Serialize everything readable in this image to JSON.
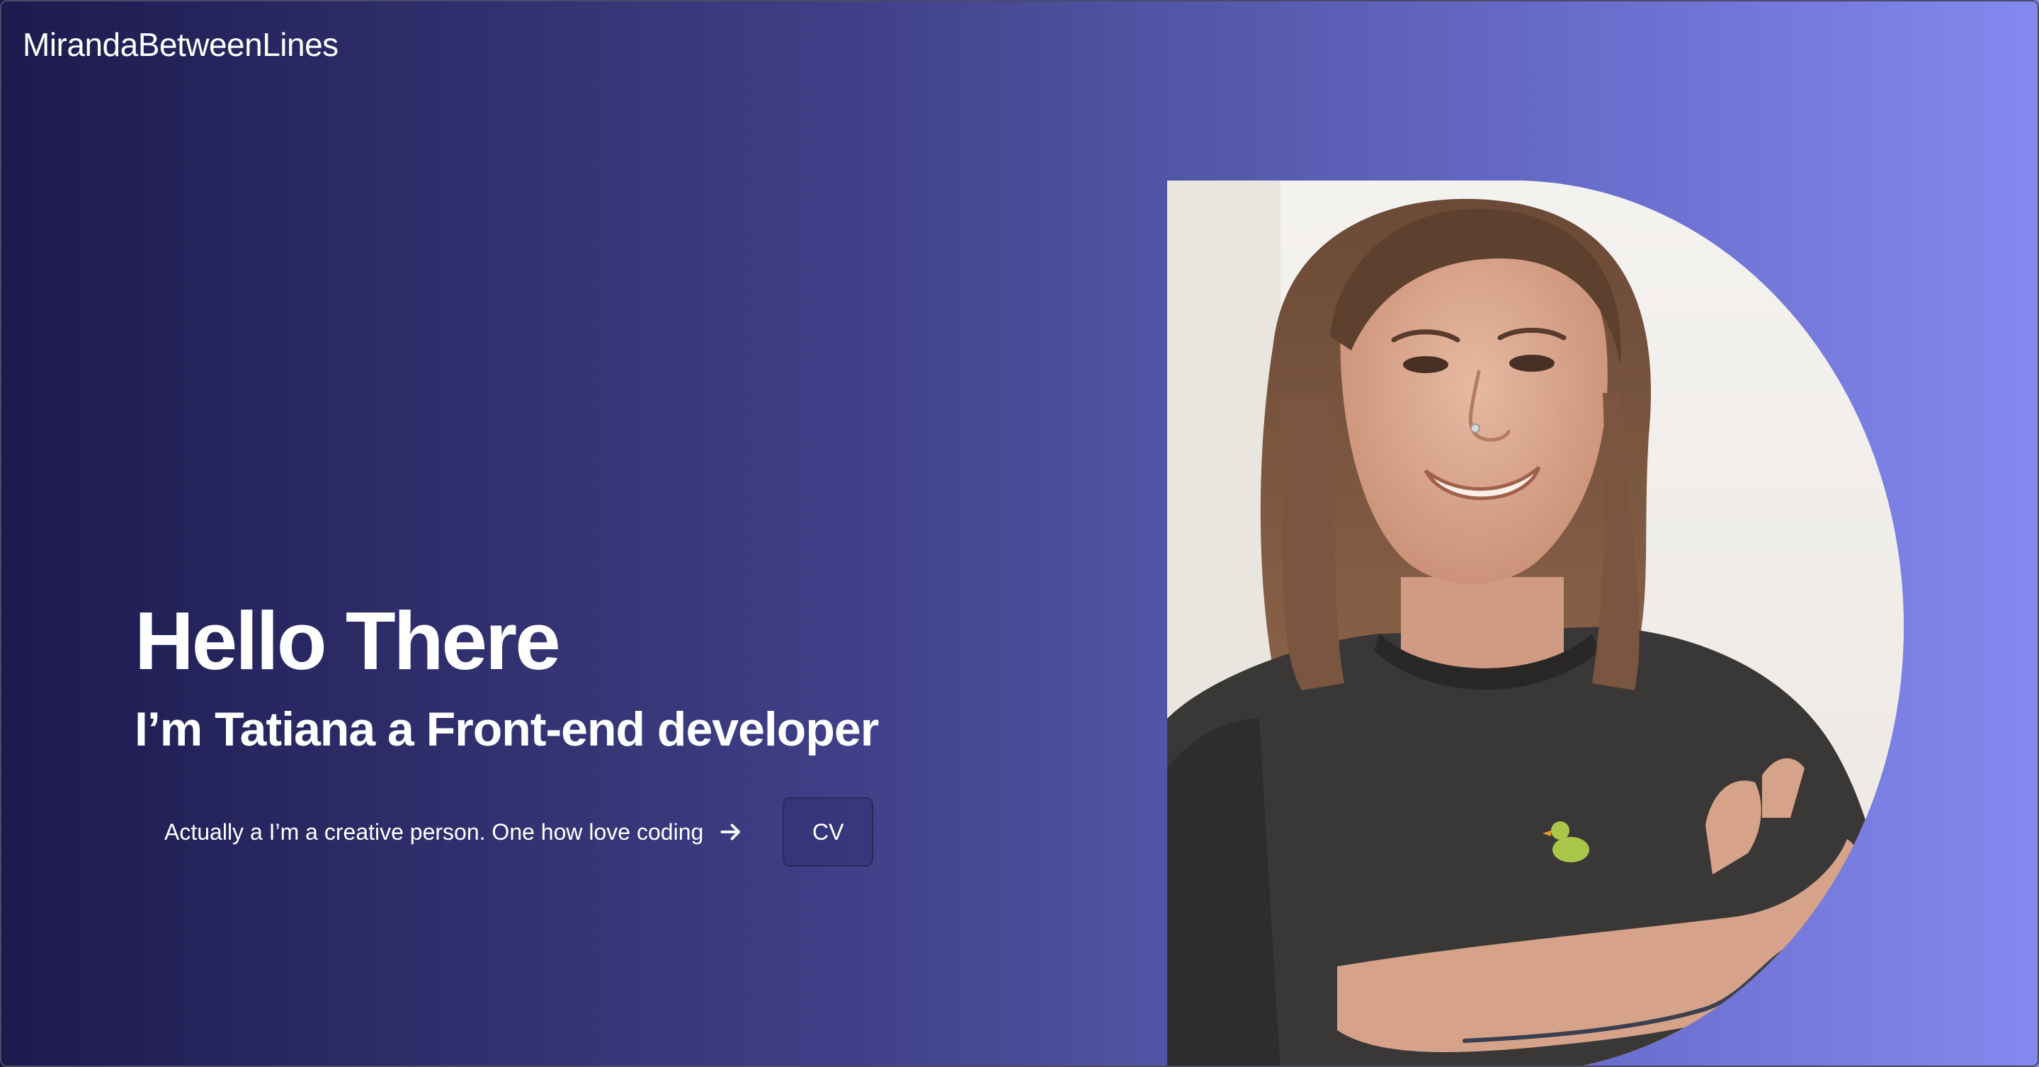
{
  "header": {
    "brand": "MirandaBetweenLines"
  },
  "hero": {
    "greeting": "Hello There",
    "subtitle": "I’m Tatiana a Front-end developer",
    "cta_text": "Actually a I’m a creative person. One how love coding",
    "cta_icon": "arrow-right-icon",
    "cv_label": "CV"
  },
  "portrait": {
    "description": "portrait-photo"
  },
  "colors": {
    "gradient_start": "#1c1a4d",
    "gradient_end": "#8489ef",
    "text": "#ffffff"
  }
}
